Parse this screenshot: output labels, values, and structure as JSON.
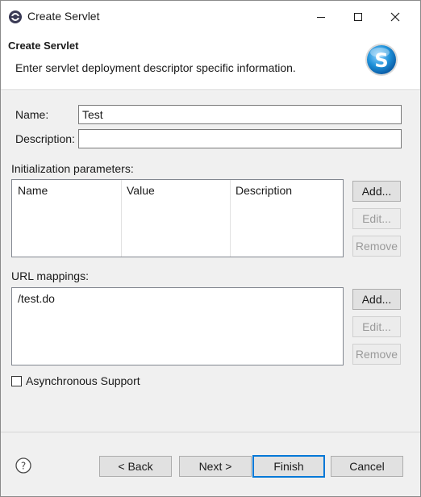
{
  "window": {
    "title": "Create Servlet",
    "controls": [
      "minimize-icon",
      "maximize-icon",
      "close-icon"
    ]
  },
  "header": {
    "title": "Create Servlet",
    "description": "Enter servlet deployment descriptor specific information.",
    "icon": "servlet-s-icon",
    "icon_color": "#1e90d8"
  },
  "form": {
    "name_label": "Name:",
    "name_value": "Test",
    "description_label": "Description:",
    "description_value": ""
  },
  "init_params": {
    "label": "Initialization parameters:",
    "columns": [
      "Name",
      "Value",
      "Description"
    ],
    "rows": [],
    "buttons": {
      "add": "Add...",
      "edit": "Edit...",
      "remove": "Remove"
    }
  },
  "url_mappings": {
    "label": "URL mappings:",
    "items": [
      "/test.do"
    ],
    "buttons": {
      "add": "Add...",
      "edit": "Edit...",
      "remove": "Remove"
    }
  },
  "async": {
    "label": "Asynchronous Support",
    "checked": false
  },
  "footer": {
    "help_icon": "help-icon",
    "back": "< Back",
    "next": "Next >",
    "finish": "Finish",
    "cancel": "Cancel"
  },
  "colors": {
    "accent": "#0078d7",
    "panel": "#f0f0f0",
    "disabled_text": "#9a9a9a"
  }
}
